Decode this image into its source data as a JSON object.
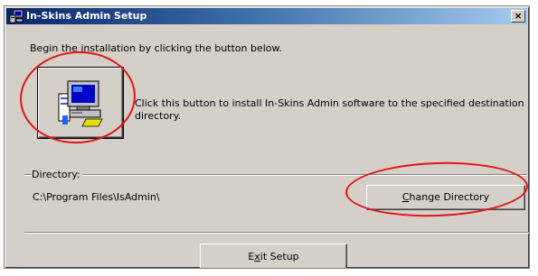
{
  "window": {
    "title": "In-Skins Admin Setup",
    "close_label": "×"
  },
  "intro_text": "Begin the installation by clicking the button below.",
  "install": {
    "description": "Click this button to install In-Skins Admin software to the specified destination directory.",
    "icon": "computer-install-icon"
  },
  "directory": {
    "group_label": "Directory:",
    "path": "C:\\Program Files\\IsAdmin\\",
    "change_button": {
      "accel": "C",
      "rest": "hange Directory"
    }
  },
  "exit_button": {
    "pre": "E",
    "accel": "x",
    "rest": "it Setup"
  },
  "colors": {
    "dialog_bg": "#d4d0c8",
    "title_gradient_start": "#0a246a",
    "title_gradient_end": "#a6caf0",
    "highlight_red": "#e3141b"
  }
}
